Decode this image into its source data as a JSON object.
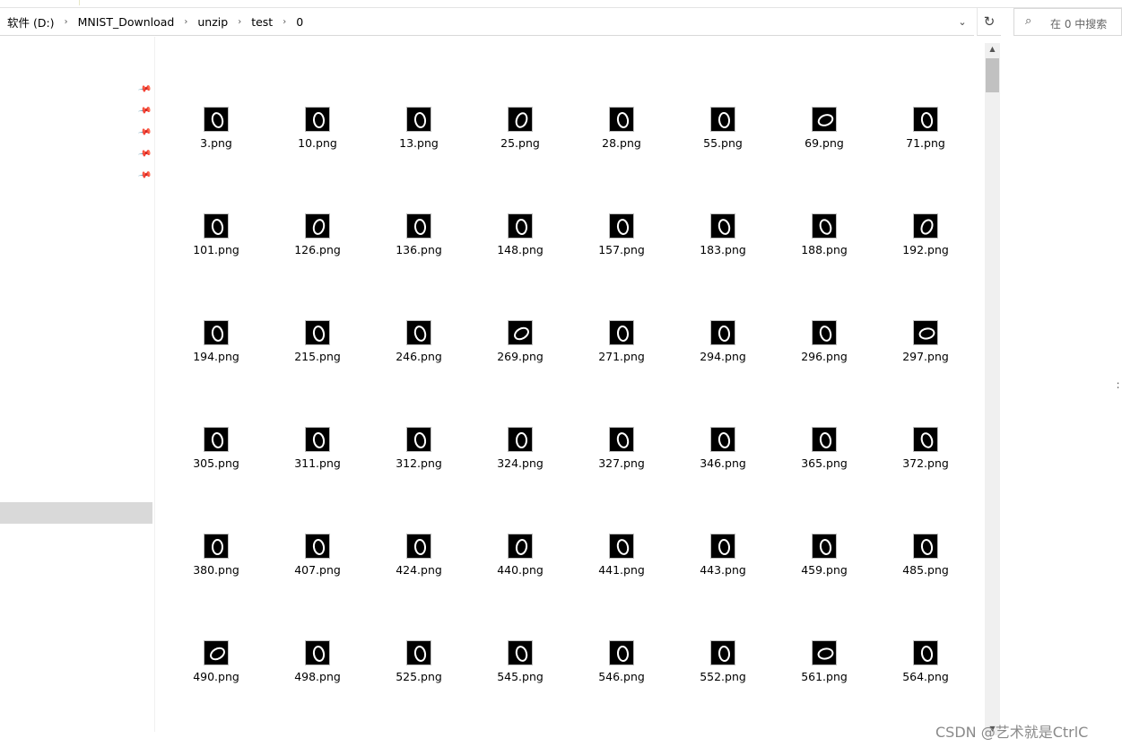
{
  "address": {
    "crumbs": [
      "软件 (D:)",
      "MNIST_Download",
      "unzip",
      "test",
      "0"
    ],
    "dropdown_glyph": "⌄",
    "refresh_glyph": "↻"
  },
  "search": {
    "placeholder": "在 0 中搜索",
    "icon": "search-icon"
  },
  "nav": {
    "pin_count": 5,
    "pin_glyph": "📌"
  },
  "files": [
    "3.png",
    "10.png",
    "13.png",
    "25.png",
    "28.png",
    "55.png",
    "69.png",
    "71.png",
    "101.png",
    "126.png",
    "136.png",
    "148.png",
    "157.png",
    "183.png",
    "188.png",
    "192.png",
    "194.png",
    "215.png",
    "246.png",
    "269.png",
    "271.png",
    "294.png",
    "296.png",
    "297.png",
    "305.png",
    "311.png",
    "312.png",
    "324.png",
    "327.png",
    "346.png",
    "365.png",
    "372.png",
    "380.png",
    "407.png",
    "424.png",
    "440.png",
    "441.png",
    "443.png",
    "459.png",
    "485.png",
    "490.png",
    "498.png",
    "525.png",
    "545.png",
    "546.png",
    "552.png",
    "561.png",
    "564.png"
  ],
  "right_edge_glyph": "∶",
  "watermark": "CSDN @艺术就是CtrlC"
}
